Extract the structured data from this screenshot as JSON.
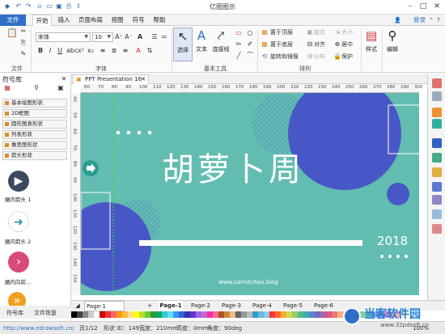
{
  "title_bar": {
    "app_title": "亿图图示",
    "quick_access": [
      "undo-icon",
      "redo-icon",
      "new-icon",
      "open-icon",
      "save-icon",
      "print-icon",
      "export-icon"
    ]
  },
  "menu": {
    "tabs": [
      "文件",
      "开始",
      "插入",
      "页面布局",
      "视图",
      "符号",
      "帮助"
    ],
    "login": "登录"
  },
  "ribbon": {
    "file_group_label": "文件",
    "font_group_label": "字体",
    "basic_tools_label": "基本工具",
    "arrange_group_label": "排列",
    "font_name": "宋体",
    "font_size": "10",
    "select_label": "选择",
    "text_label": "文本",
    "connector_label": "连接线",
    "bring_front": "置于顶层",
    "send_back": "置于底层",
    "rotate_mirror": "旋转和镜像",
    "group": "组合",
    "align": "对齐",
    "distribute": "分布",
    "size": "大小",
    "same_center": "居中",
    "protect": "保护",
    "style_label": "样式",
    "edit_label": "编辑"
  },
  "left_panel": {
    "title": "符号库",
    "libraries": [
      "基本绘图形状",
      "2D框图",
      "圆形图表形状",
      "列表形状",
      "像思图形状",
      "箭头形状"
    ],
    "shapes": [
      {
        "label": "圈内箭头 1",
        "color": "#3b4a60",
        "glyph": "▶"
      },
      {
        "label": "圈内箭头 2",
        "color": "#ffffff",
        "glyph": "➜"
      },
      {
        "label": "圈内向前...",
        "color": "#d84a7a",
        "glyph": "›"
      },
      {
        "label": "",
        "color": "#f0a020",
        "glyph": "»"
      }
    ],
    "bottom_tabs": [
      "符号库",
      "文件恢复"
    ]
  },
  "document": {
    "tab_title": "PPT Presentation 16",
    "ruler_h": [
      "60",
      "70",
      "80",
      "90",
      "100",
      "110",
      "120",
      "130",
      "140",
      "150",
      "160",
      "170",
      "180",
      "190",
      "200",
      "210",
      "220",
      "230",
      "240",
      "250",
      "260",
      "270",
      "280",
      "290",
      "300"
    ],
    "ruler_v": [
      "40",
      "50",
      "60",
      "70",
      "80",
      "90",
      "100",
      "110",
      "120",
      "130",
      "140",
      "150"
    ]
  },
  "slide": {
    "title": "胡萝卜周",
    "year": "2018",
    "url": "www.carrotchou.blog",
    "colors": {
      "bg": "#62bdb0",
      "circle": "#4857c6",
      "white": "#ffffff"
    }
  },
  "page_bar": {
    "current_page_label": "Page-1",
    "pages": [
      "Page-1",
      "Page-2",
      "Page-3",
      "Page-4",
      "Page-5",
      "Page-6"
    ]
  },
  "status": {
    "website": "http://www.edrawsoft.cn/",
    "page": "页1/12",
    "shape_id": "形状 ID：149",
    "width": "宽度：210mm",
    "height": "高度：0mm",
    "angle": "角度：90deg",
    "zoom": "100%"
  },
  "watermark": {
    "name": "当客软件园",
    "url": "www.32pdsoft.cn"
  }
}
